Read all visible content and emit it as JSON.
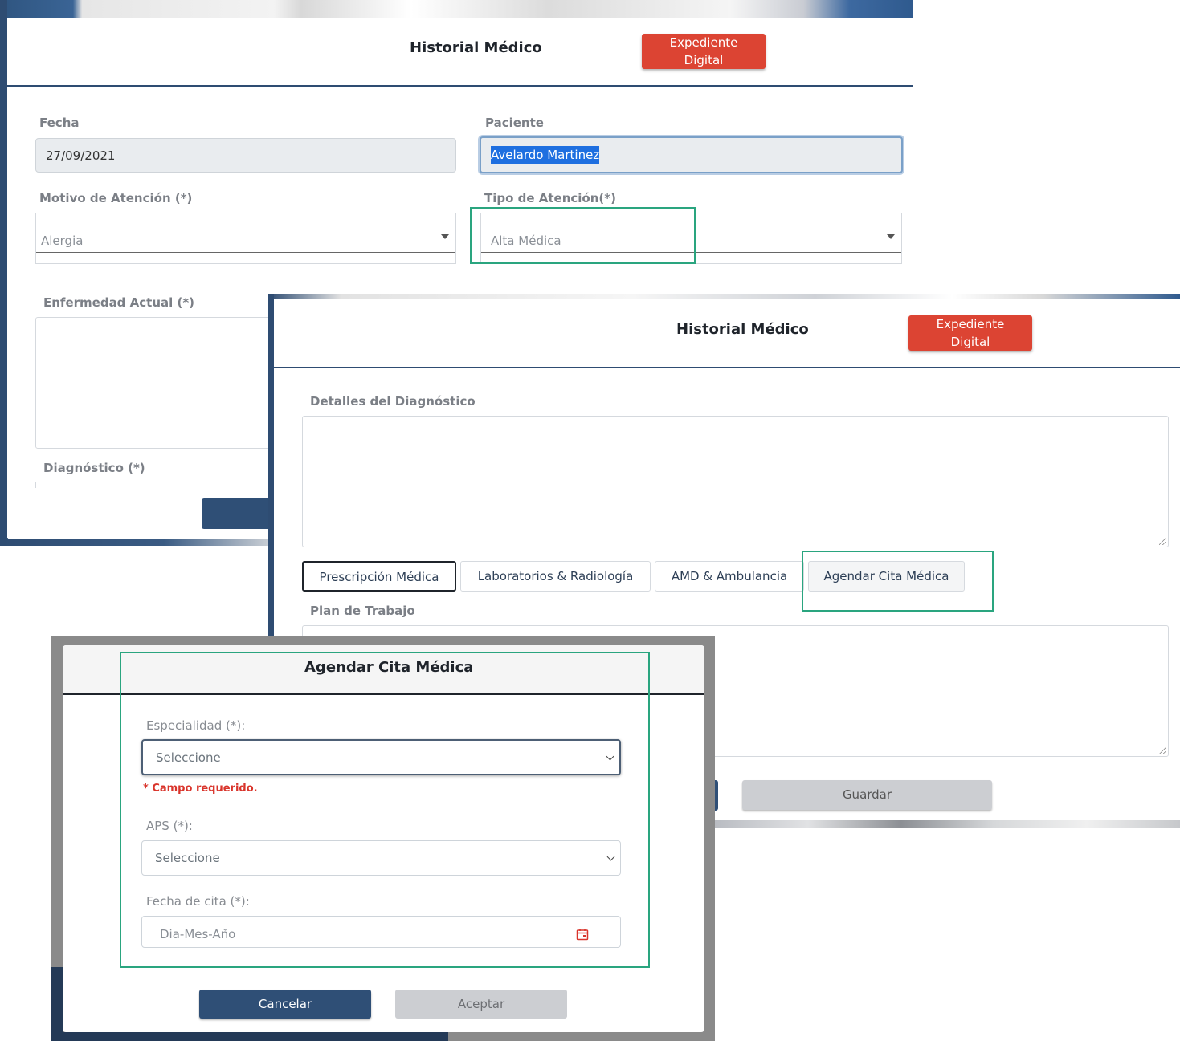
{
  "window1": {
    "title": "Historial Médico",
    "expediente_label": "Expediente\nDigital",
    "fecha": {
      "label": "Fecha",
      "value": "27/09/2021"
    },
    "paciente": {
      "label": "Paciente",
      "value": "Avelardo Martinez"
    },
    "motivo": {
      "label": "Motivo de Atención (*)",
      "value": "Alergia"
    },
    "tipo": {
      "label": "Tipo de Atención(*)",
      "value": "Alta Médica"
    },
    "enfermedad_label": "Enfermedad Actual (*)",
    "diagnostico_label": "Diagnóstico (*)"
  },
  "window2": {
    "title": "Historial Médico",
    "expediente_label": "Expediente\nDigital",
    "detalles_label": "Detalles del Diagnóstico",
    "tabs": [
      {
        "label": "Prescripción Médica"
      },
      {
        "label": "Laboratorios & Radiología"
      },
      {
        "label": "AMD & Ambulancia"
      },
      {
        "label": "Agendar Cita Médica"
      }
    ],
    "plan_label": "Plan de Trabajo",
    "guardar_label": "Guardar"
  },
  "modal": {
    "title": "Agendar Cita Médica",
    "especialidad": {
      "label": "Especialidad (*):",
      "value": "Seleccione"
    },
    "required_msg": "* Campo requerido.",
    "aps": {
      "label": "APS (*):",
      "value": "Seleccione"
    },
    "fecha_cita": {
      "label": "Fecha de cita (*):",
      "placeholder": "Dia-Mes-Año"
    },
    "cancelar_label": "Cancelar",
    "aceptar_label": "Aceptar"
  },
  "colors": {
    "accent_red": "#dc4433",
    "primary_navy": "#2f4f76",
    "highlight_green": "#2aa57f",
    "error_red": "#d9342b",
    "disabled_gray": "#ccced2"
  }
}
